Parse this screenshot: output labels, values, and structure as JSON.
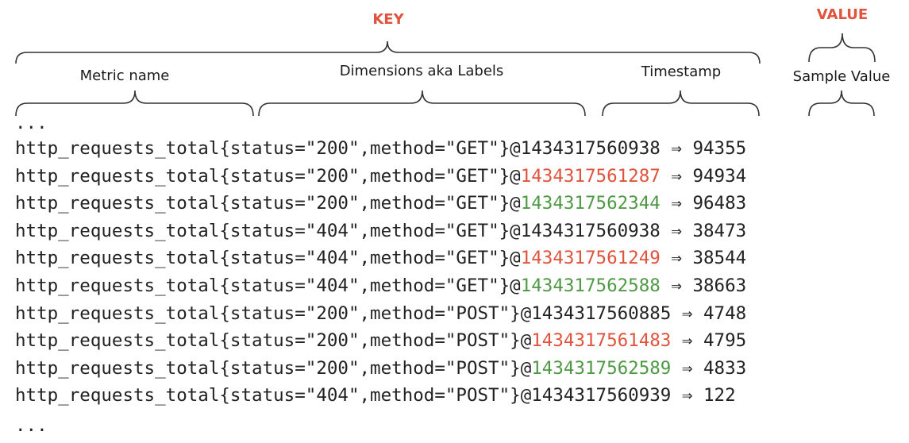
{
  "colors": {
    "key": "#e0533d",
    "red": "#e0533d",
    "green": "#4e9a44",
    "line": "#333333"
  },
  "labels": {
    "key": "KEY",
    "value": "VALUE",
    "metric_name": "Metric name",
    "dimensions": "Dimensions aka Labels",
    "timestamp": "Timestamp",
    "sample_value": "Sample Value"
  },
  "ellipsis_top": "...",
  "ellipsis_bottom": "...",
  "rows": [
    {
      "metric": "http_requests_total",
      "status": "200",
      "method": "GET",
      "timestamp": "1434317560938",
      "ts_color": "default",
      "value": "94355"
    },
    {
      "metric": "http_requests_total",
      "status": "200",
      "method": "GET",
      "timestamp": "1434317561287",
      "ts_color": "red",
      "value": "94934"
    },
    {
      "metric": "http_requests_total",
      "status": "200",
      "method": "GET",
      "timestamp": "1434317562344",
      "ts_color": "green",
      "value": "96483"
    },
    {
      "metric": "http_requests_total",
      "status": "404",
      "method": "GET",
      "timestamp": "1434317560938",
      "ts_color": "default",
      "value": "38473"
    },
    {
      "metric": "http_requests_total",
      "status": "404",
      "method": "GET",
      "timestamp": "1434317561249",
      "ts_color": "red",
      "value": "38544"
    },
    {
      "metric": "http_requests_total",
      "status": "404",
      "method": "GET",
      "timestamp": "1434317562588",
      "ts_color": "green",
      "value": "38663"
    },
    {
      "metric": "http_requests_total",
      "status": "200",
      "method": "POST",
      "timestamp": "1434317560885",
      "ts_color": "default",
      "value": "4748"
    },
    {
      "metric": "http_requests_total",
      "status": "200",
      "method": "POST",
      "timestamp": "1434317561483",
      "ts_color": "red",
      "value": "4795"
    },
    {
      "metric": "http_requests_total",
      "status": "200",
      "method": "POST",
      "timestamp": "1434317562589",
      "ts_color": "green",
      "value": "4833"
    },
    {
      "metric": "http_requests_total",
      "status": "404",
      "method": "POST",
      "timestamp": "1434317560939",
      "ts_color": "default",
      "value": "122"
    }
  ]
}
